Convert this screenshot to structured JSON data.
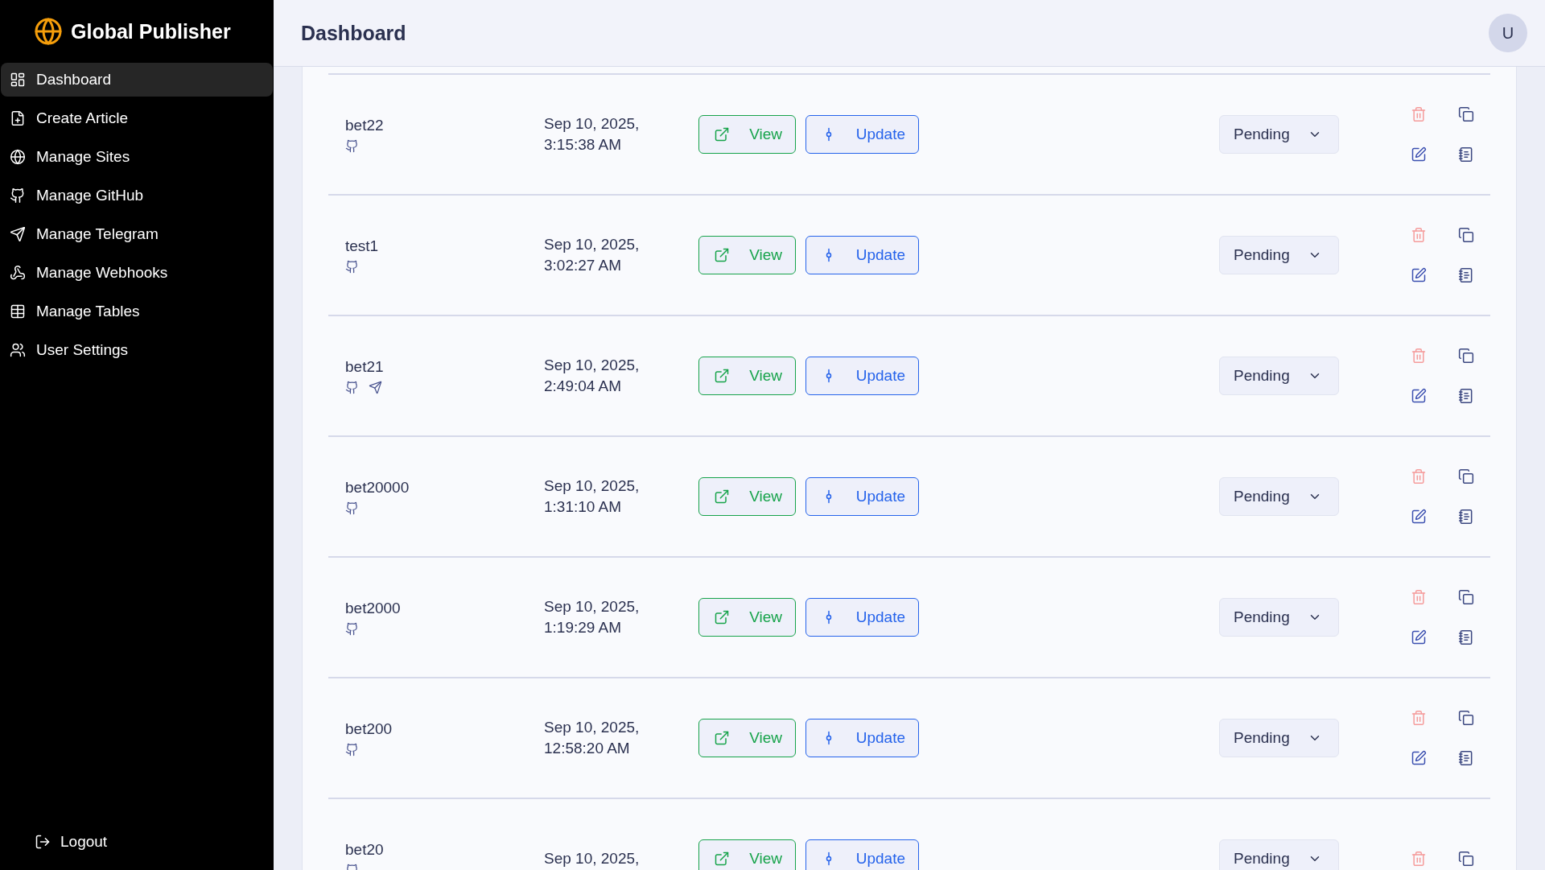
{
  "brand": {
    "name": "Global Publisher"
  },
  "sidebar": {
    "items": [
      {
        "label": "Dashboard",
        "selected": true
      },
      {
        "label": "Create Article",
        "selected": false
      },
      {
        "label": "Manage Sites",
        "selected": false
      },
      {
        "label": "Manage GitHub",
        "selected": false
      },
      {
        "label": "Manage Telegram",
        "selected": false
      },
      {
        "label": "Manage Webhooks",
        "selected": false
      },
      {
        "label": "Manage Tables",
        "selected": false
      },
      {
        "label": "User Settings",
        "selected": false
      }
    ],
    "logout": "Logout"
  },
  "header": {
    "title": "Dashboard",
    "avatar": "U"
  },
  "articles": [
    {
      "name": "bet22",
      "telegram": false,
      "date": [
        "Sep 10, 2025,",
        "3:15:38 AM"
      ],
      "view": "View",
      "update": "Update",
      "status": "Pending"
    },
    {
      "name": "test1",
      "telegram": false,
      "date": [
        "Sep 10, 2025,",
        "3:02:27 AM"
      ],
      "view": "View",
      "update": "Update",
      "status": "Pending"
    },
    {
      "name": "bet21",
      "telegram": true,
      "date": [
        "Sep 10, 2025,",
        "2:49:04 AM"
      ],
      "view": "View",
      "update": "Update",
      "status": "Pending"
    },
    {
      "name": "bet20000",
      "telegram": false,
      "date": [
        "Sep 10, 2025,",
        "1:31:10 AM"
      ],
      "view": "View",
      "update": "Update",
      "status": "Pending"
    },
    {
      "name": "bet2000",
      "telegram": false,
      "date": [
        "Sep 10, 2025,",
        "1:19:29 AM"
      ],
      "view": "View",
      "update": "Update",
      "status": "Pending"
    },
    {
      "name": "bet200",
      "telegram": false,
      "date": [
        "Sep 10, 2025,",
        "12:58:20 AM"
      ],
      "view": "View",
      "update": "Update",
      "status": "Pending"
    },
    {
      "name": "bet20",
      "telegram": false,
      "date": [
        "Sep 10, 2025,"
      ],
      "view": "View",
      "update": "Update",
      "status": "Pending"
    }
  ]
}
